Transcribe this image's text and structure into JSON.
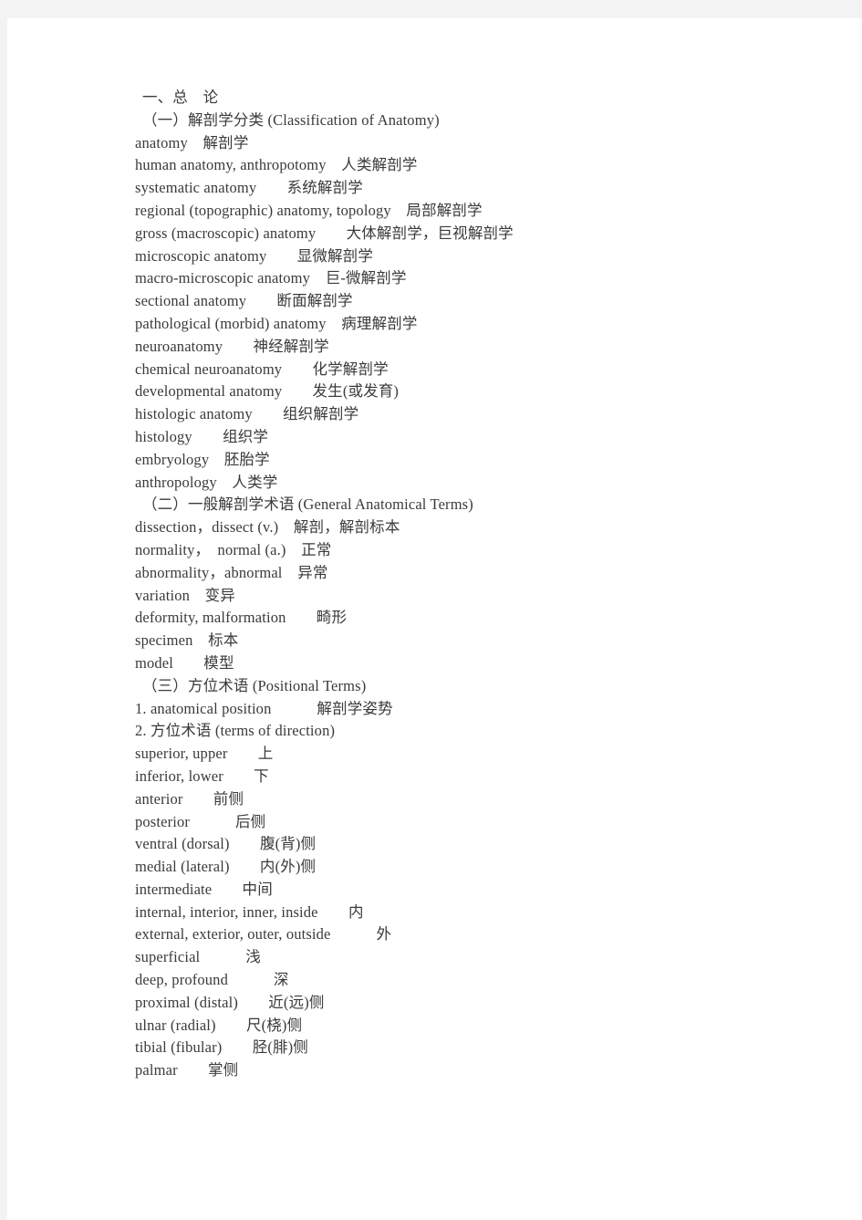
{
  "document": {
    "type": "scanned-glossary-page",
    "page_background": "#ffffff",
    "margin_background": "#f3f3f4",
    "text_color": "#3a3a3c"
  },
  "lines": [
    {
      "text": "一、总　论",
      "indent": true
    },
    {
      "text": "（一）解剖学分类 (Classification of Anatomy)",
      "indent": true
    },
    {
      "text": "anatomy　解剖学",
      "indent": false
    },
    {
      "text": "human anatomy, anthropotomy　人类解剖学",
      "indent": false
    },
    {
      "text": "systematic anatomy　　系统解剖学",
      "indent": false
    },
    {
      "text": "regional (topographic) anatomy, topology　局部解剖学",
      "indent": false
    },
    {
      "text": "gross (macroscopic) anatomy　　大体解剖学，巨视解剖学",
      "indent": false
    },
    {
      "text": "microscopic anatomy　　显微解剖学",
      "indent": false
    },
    {
      "text": "macro-microscopic anatomy　巨-微解剖学",
      "indent": false
    },
    {
      "text": "sectional anatomy　　断面解剖学",
      "indent": false
    },
    {
      "text": "pathological (morbid) anatomy　病理解剖学",
      "indent": false
    },
    {
      "text": "neuroanatomy　　神经解剖学",
      "indent": false
    },
    {
      "text": "chemical neuroanatomy　　化学解剖学",
      "indent": false
    },
    {
      "text": "developmental anatomy　　发生(或发育)",
      "indent": false
    },
    {
      "text": "histologic anatomy　　组织解剖学",
      "indent": false
    },
    {
      "text": "histology　　组织学",
      "indent": false
    },
    {
      "text": "embryology　胚胎学",
      "indent": false
    },
    {
      "text": "anthropology　人类学",
      "indent": false
    },
    {
      "text": "（二）一般解剖学术语 (General Anatomical Terms)",
      "indent": true
    },
    {
      "text": "dissection，dissect (v.)　解剖，解剖标本",
      "indent": false
    },
    {
      "text": "normality，　normal (a.)　正常",
      "indent": false
    },
    {
      "text": "abnormality，abnormal　异常",
      "indent": false
    },
    {
      "text": "variation　变异",
      "indent": false
    },
    {
      "text": "deformity, malformation　　畸形",
      "indent": false
    },
    {
      "text": "specimen　标本",
      "indent": false
    },
    {
      "text": "model　　模型",
      "indent": false
    },
    {
      "text": "（三）方位术语 (Positional Terms)",
      "indent": true
    },
    {
      "text": "1. anatomical position　　　解剖学姿势",
      "indent": false
    },
    {
      "text": "2. 方位术语 (terms of direction)",
      "indent": false
    },
    {
      "text": "superior, upper　　上",
      "indent": false
    },
    {
      "text": "inferior, lower　　下",
      "indent": false
    },
    {
      "text": "anterior　　前侧",
      "indent": false
    },
    {
      "text": "posterior　　　后侧",
      "indent": false
    },
    {
      "text": "ventral (dorsal)　　腹(背)侧",
      "indent": false
    },
    {
      "text": "medial (lateral)　　内(外)侧",
      "indent": false
    },
    {
      "text": "intermediate　　中间",
      "indent": false
    },
    {
      "text": "internal, interior, inner, inside　　内",
      "indent": false
    },
    {
      "text": "external, exterior, outer, outside　　　外",
      "indent": false
    },
    {
      "text": "superficial　　　浅",
      "indent": false
    },
    {
      "text": "deep, profound　　　深",
      "indent": false
    },
    {
      "text": "proximal (distal)　　近(远)侧",
      "indent": false
    },
    {
      "text": "ulnar (radial)　　尺(桡)侧",
      "indent": false
    },
    {
      "text": "tibial (fibular)　　胫(腓)侧",
      "indent": false
    },
    {
      "text": "palmar　　掌侧",
      "indent": false
    }
  ]
}
